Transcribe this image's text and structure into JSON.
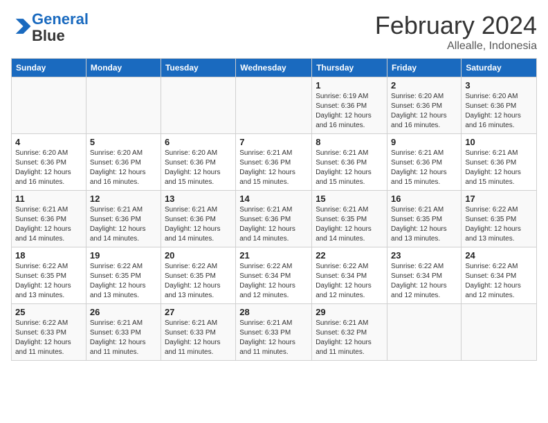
{
  "logo": {
    "line1": "General",
    "line2": "Blue"
  },
  "title": "February 2024",
  "location": "Allealle, Indonesia",
  "days_of_week": [
    "Sunday",
    "Monday",
    "Tuesday",
    "Wednesday",
    "Thursday",
    "Friday",
    "Saturday"
  ],
  "weeks": [
    [
      {
        "num": "",
        "info": ""
      },
      {
        "num": "",
        "info": ""
      },
      {
        "num": "",
        "info": ""
      },
      {
        "num": "",
        "info": ""
      },
      {
        "num": "1",
        "info": "Sunrise: 6:19 AM\nSunset: 6:36 PM\nDaylight: 12 hours and 16 minutes."
      },
      {
        "num": "2",
        "info": "Sunrise: 6:20 AM\nSunset: 6:36 PM\nDaylight: 12 hours and 16 minutes."
      },
      {
        "num": "3",
        "info": "Sunrise: 6:20 AM\nSunset: 6:36 PM\nDaylight: 12 hours and 16 minutes."
      }
    ],
    [
      {
        "num": "4",
        "info": "Sunrise: 6:20 AM\nSunset: 6:36 PM\nDaylight: 12 hours and 16 minutes."
      },
      {
        "num": "5",
        "info": "Sunrise: 6:20 AM\nSunset: 6:36 PM\nDaylight: 12 hours and 16 minutes."
      },
      {
        "num": "6",
        "info": "Sunrise: 6:20 AM\nSunset: 6:36 PM\nDaylight: 12 hours and 15 minutes."
      },
      {
        "num": "7",
        "info": "Sunrise: 6:21 AM\nSunset: 6:36 PM\nDaylight: 12 hours and 15 minutes."
      },
      {
        "num": "8",
        "info": "Sunrise: 6:21 AM\nSunset: 6:36 PM\nDaylight: 12 hours and 15 minutes."
      },
      {
        "num": "9",
        "info": "Sunrise: 6:21 AM\nSunset: 6:36 PM\nDaylight: 12 hours and 15 minutes."
      },
      {
        "num": "10",
        "info": "Sunrise: 6:21 AM\nSunset: 6:36 PM\nDaylight: 12 hours and 15 minutes."
      }
    ],
    [
      {
        "num": "11",
        "info": "Sunrise: 6:21 AM\nSunset: 6:36 PM\nDaylight: 12 hours and 14 minutes."
      },
      {
        "num": "12",
        "info": "Sunrise: 6:21 AM\nSunset: 6:36 PM\nDaylight: 12 hours and 14 minutes."
      },
      {
        "num": "13",
        "info": "Sunrise: 6:21 AM\nSunset: 6:36 PM\nDaylight: 12 hours and 14 minutes."
      },
      {
        "num": "14",
        "info": "Sunrise: 6:21 AM\nSunset: 6:36 PM\nDaylight: 12 hours and 14 minutes."
      },
      {
        "num": "15",
        "info": "Sunrise: 6:21 AM\nSunset: 6:35 PM\nDaylight: 12 hours and 14 minutes."
      },
      {
        "num": "16",
        "info": "Sunrise: 6:21 AM\nSunset: 6:35 PM\nDaylight: 12 hours and 13 minutes."
      },
      {
        "num": "17",
        "info": "Sunrise: 6:22 AM\nSunset: 6:35 PM\nDaylight: 12 hours and 13 minutes."
      }
    ],
    [
      {
        "num": "18",
        "info": "Sunrise: 6:22 AM\nSunset: 6:35 PM\nDaylight: 12 hours and 13 minutes."
      },
      {
        "num": "19",
        "info": "Sunrise: 6:22 AM\nSunset: 6:35 PM\nDaylight: 12 hours and 13 minutes."
      },
      {
        "num": "20",
        "info": "Sunrise: 6:22 AM\nSunset: 6:35 PM\nDaylight: 12 hours and 13 minutes."
      },
      {
        "num": "21",
        "info": "Sunrise: 6:22 AM\nSunset: 6:34 PM\nDaylight: 12 hours and 12 minutes."
      },
      {
        "num": "22",
        "info": "Sunrise: 6:22 AM\nSunset: 6:34 PM\nDaylight: 12 hours and 12 minutes."
      },
      {
        "num": "23",
        "info": "Sunrise: 6:22 AM\nSunset: 6:34 PM\nDaylight: 12 hours and 12 minutes."
      },
      {
        "num": "24",
        "info": "Sunrise: 6:22 AM\nSunset: 6:34 PM\nDaylight: 12 hours and 12 minutes."
      }
    ],
    [
      {
        "num": "25",
        "info": "Sunrise: 6:22 AM\nSunset: 6:33 PM\nDaylight: 12 hours and 11 minutes."
      },
      {
        "num": "26",
        "info": "Sunrise: 6:21 AM\nSunset: 6:33 PM\nDaylight: 12 hours and 11 minutes."
      },
      {
        "num": "27",
        "info": "Sunrise: 6:21 AM\nSunset: 6:33 PM\nDaylight: 12 hours and 11 minutes."
      },
      {
        "num": "28",
        "info": "Sunrise: 6:21 AM\nSunset: 6:33 PM\nDaylight: 12 hours and 11 minutes."
      },
      {
        "num": "29",
        "info": "Sunrise: 6:21 AM\nSunset: 6:32 PM\nDaylight: 12 hours and 11 minutes."
      },
      {
        "num": "",
        "info": ""
      },
      {
        "num": "",
        "info": ""
      }
    ]
  ]
}
